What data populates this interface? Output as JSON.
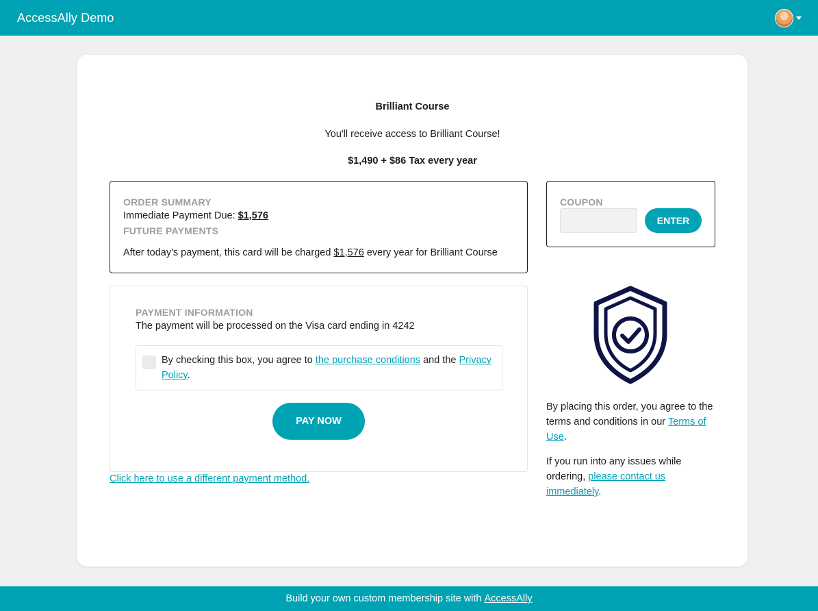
{
  "header": {
    "title": "AccessAlly Demo",
    "avatar_icon": "user-avatar",
    "menu_icon": "caret-down-icon"
  },
  "product": {
    "title": "Brilliant Course",
    "subtitle": "You'll receive access to Brilliant Course!",
    "price": "$1,490 + $86 Tax every year"
  },
  "order_summary": {
    "heading": "ORDER SUMMARY",
    "immediate_label": "Immediate Payment Due:",
    "immediate_amount": "$1,576",
    "future_heading": "FUTURE PAYMENTS",
    "future_prefix": "After today's payment, this card will be charged",
    "future_amount": "$1,576",
    "future_suffix": "every year for Brilliant Course"
  },
  "coupon": {
    "heading": "COUPON",
    "value": "",
    "placeholder": "",
    "button_label": "ENTER"
  },
  "payment": {
    "heading": "PAYMENT INFORMATION",
    "card_text": "The payment will be processed on the Visa card ending in 4242",
    "agree_prefix": "By checking this box, you agree to",
    "agree_link1": "the purchase conditions",
    "agree_middle": "and the",
    "agree_link2": "Privacy Policy",
    "agree_suffix": ".",
    "pay_button": "PAY NOW",
    "alt_method": "Click here to use a different payment method."
  },
  "legal": {
    "shield_icon": "shield-check-icon",
    "terms_prefix": "By placing this order, you agree to the terms and conditions in our",
    "terms_link": "Terms of Use",
    "terms_suffix": ".",
    "contact_prefix": "If you run into any issues while ordering,",
    "contact_link": "please contact us immediately",
    "contact_suffix": "."
  },
  "footer": {
    "text": "Build your own custom membership site with",
    "link": "AccessAlly"
  },
  "colors": {
    "accent": "#00a3b4",
    "shield": "#0e1446",
    "muted_heading": "#9e9e9e"
  }
}
